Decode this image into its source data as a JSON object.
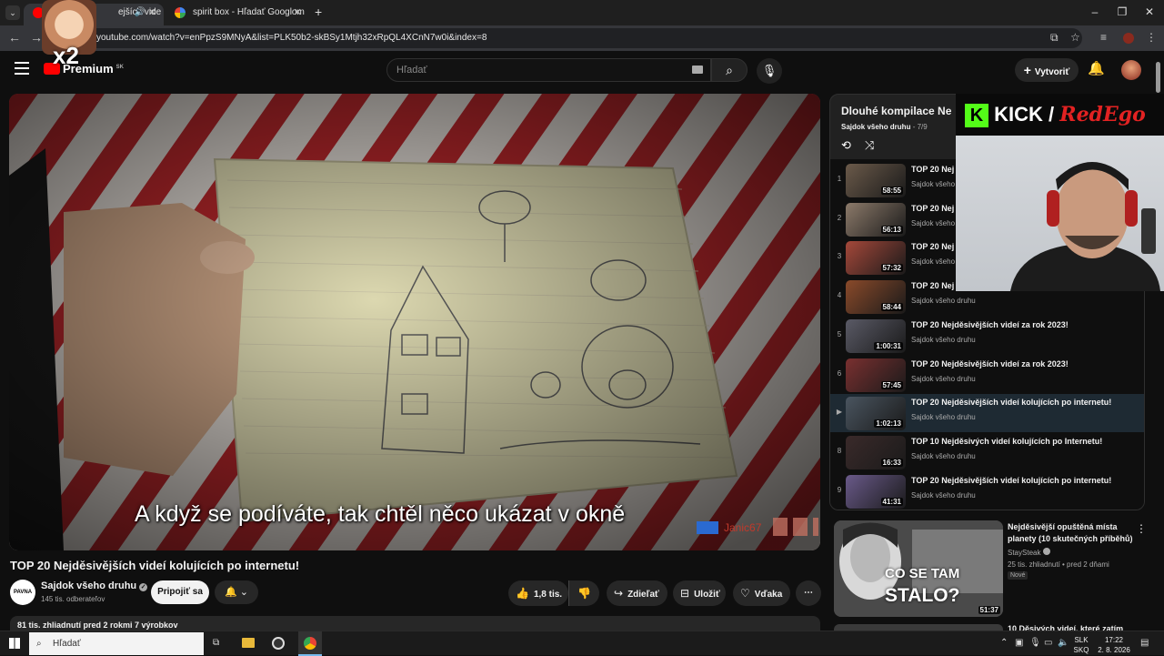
{
  "browser": {
    "tabs": [
      {
        "title": "ejších vide",
        "active": true
      },
      {
        "title": "spirit box - Hľadať Googlom",
        "active": false
      }
    ],
    "new_tab": "+",
    "url": "youtube.com/watch?v=enPpzS9MNyA&list=PLK50b2-skBSy1Mtjh32xRpQL4XCnN7w0i&index=8",
    "minimize": "‒",
    "restore": "❐",
    "close": "✕"
  },
  "overlay": {
    "multiplier": "x2",
    "kick_label": "KICK",
    "kick_slash": "/",
    "kick_name": "RedEgo",
    "chat_user": "Janic67"
  },
  "youtube": {
    "logo_text": "Premium",
    "logo_region": "SK",
    "search_placeholder": "Hľadať",
    "create_label": "Vytvoriť",
    "create_plus": "+"
  },
  "video": {
    "subtitle": "A když se podíváte, tak chtěl něco ukázat v okně",
    "title": "TOP 20 Nejděsivějších videí kolujících po internetu!",
    "channel_avatar_text": "PAVNA",
    "channel": "Sajdok všeho druhu",
    "verified": "✓",
    "subscribers": "145 tis. odberateľov",
    "join_label": "Pripojiť sa",
    "likes": "1,8 tis.",
    "share_label": "Zdieľať",
    "save_label": "Uložiť",
    "thanks_label": "Vďaka",
    "more": "⋯",
    "description_meta": "81 tis. zhliadnutí  pred 2 rokmi  7 výrobkov"
  },
  "playlist": {
    "title": "Dlouhé kompilace Ne",
    "owner": "Sajdok všeho druhu",
    "position": " - 7/9",
    "items": [
      {
        "index": "1",
        "title": "TOP 20 Nej",
        "channel": "Sajdok všeho druhu",
        "duration": "58:55",
        "color": "#6b5a4a"
      },
      {
        "index": "2",
        "title": "TOP 20 Nej",
        "channel": "Sajdok všeho druhu",
        "duration": "56:13",
        "color": "#8c7a6a"
      },
      {
        "index": "3",
        "title": "TOP 20 Nej",
        "channel": "Sajdok všeho druhu",
        "duration": "57:32",
        "color": "#a5483a"
      },
      {
        "index": "4",
        "title": "TOP 20 Nej",
        "channel": "Sajdok všeho druhu",
        "duration": "58:44",
        "color": "#8a4a2a"
      },
      {
        "index": "5",
        "title": "TOP 20 Nejděsivějších videí za rok 2023!",
        "channel": "Sajdok všeho druhu",
        "duration": "1:00:31",
        "color": "#5a5a66"
      },
      {
        "index": "6",
        "title": "TOP 20 Nejděsivějších videí za rok 2023!",
        "channel": "Sajdok všeho druhu",
        "duration": "57:45",
        "color": "#7a3030"
      },
      {
        "index": "▶",
        "title": "TOP 20 Nejděsivějších videí kolujících po internetu!",
        "channel": "Sajdok všeho druhu",
        "duration": "1:02:13",
        "color": "#4a5560",
        "current": true
      },
      {
        "index": "8",
        "title": "TOP 10 Nejděsivých videí kolujících po Internetu!",
        "channel": "Sajdok všeho druhu",
        "duration": "16:33",
        "color": "#3a2a2a"
      },
      {
        "index": "9",
        "title": "TOP 20 Nejděsivějších videí kolujících po internetu!",
        "channel": "Sajdok všeho druhu",
        "duration": "41:31",
        "color": "#6a5a8a"
      }
    ]
  },
  "recommendation": {
    "title": "Nejděsivější opuštěná místa planety (10 skutečných příběhů)",
    "channel": "StaySteak",
    "meta": "25 tis. zhliadnutí  •  pred 2 dňami",
    "badge": "Nové",
    "duration": "51:37",
    "thumb_text_1": "CO SE TAM",
    "thumb_text_2": "STALO?",
    "next_title": "10 Děsivých videí, které zatím",
    "menu": "⋮"
  },
  "taskbar": {
    "search_placeholder": "Hľadať",
    "lang_1": "SLK",
    "lang_2": "SKQ",
    "time": "17:22",
    "date": "2. 8. 2026"
  }
}
